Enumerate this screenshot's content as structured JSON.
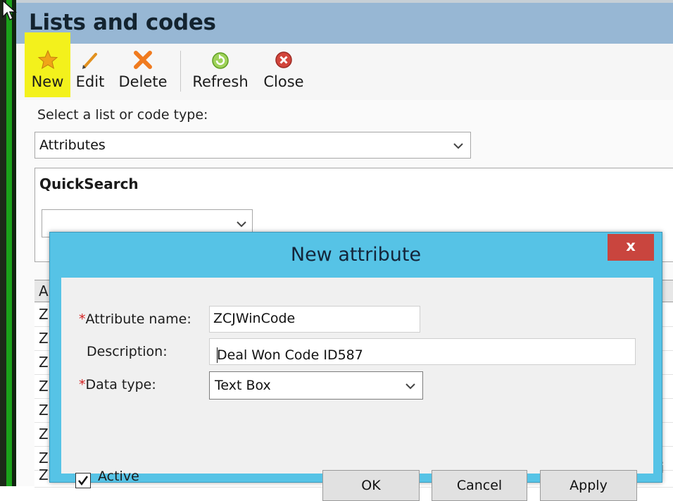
{
  "app": {
    "title": "Lists and codes"
  },
  "toolbar": {
    "new_label": "New",
    "edit_label": "Edit",
    "delete_label": "Delete",
    "refresh_label": "Refresh",
    "close_label": "Close",
    "highlight_color": "#f3f11c"
  },
  "list_selector": {
    "label": "Select a list or code type:",
    "selected": "Attributes"
  },
  "quicksearch": {
    "title": "QuickSearch",
    "value": ""
  },
  "grid": {
    "header_fragment": "A",
    "row_fragment": "Z",
    "right_fragment": "hi"
  },
  "dialog": {
    "title": "New attribute",
    "close_label": "x",
    "required_marker": "*",
    "fields": {
      "attribute_name": {
        "label": "Attribute name:",
        "value": "ZCJWinCode"
      },
      "description": {
        "label": "Description:",
        "value": "Deal Won Code ID587"
      },
      "data_type": {
        "label": "Data type:",
        "value": "Text Box"
      }
    },
    "active": {
      "label": "Active",
      "checked": true
    },
    "buttons": {
      "ok": "OK",
      "cancel": "Cancel",
      "apply": "Apply"
    },
    "colors": {
      "frame": "#56c3e6",
      "close_button": "#c9453e"
    }
  },
  "icons": [
    "star-icon",
    "pencil-icon",
    "delete-x-icon",
    "refresh-icon",
    "close-circle-icon",
    "chevron-down-icon",
    "checkmark-icon",
    "mouse-cursor-icon"
  ]
}
